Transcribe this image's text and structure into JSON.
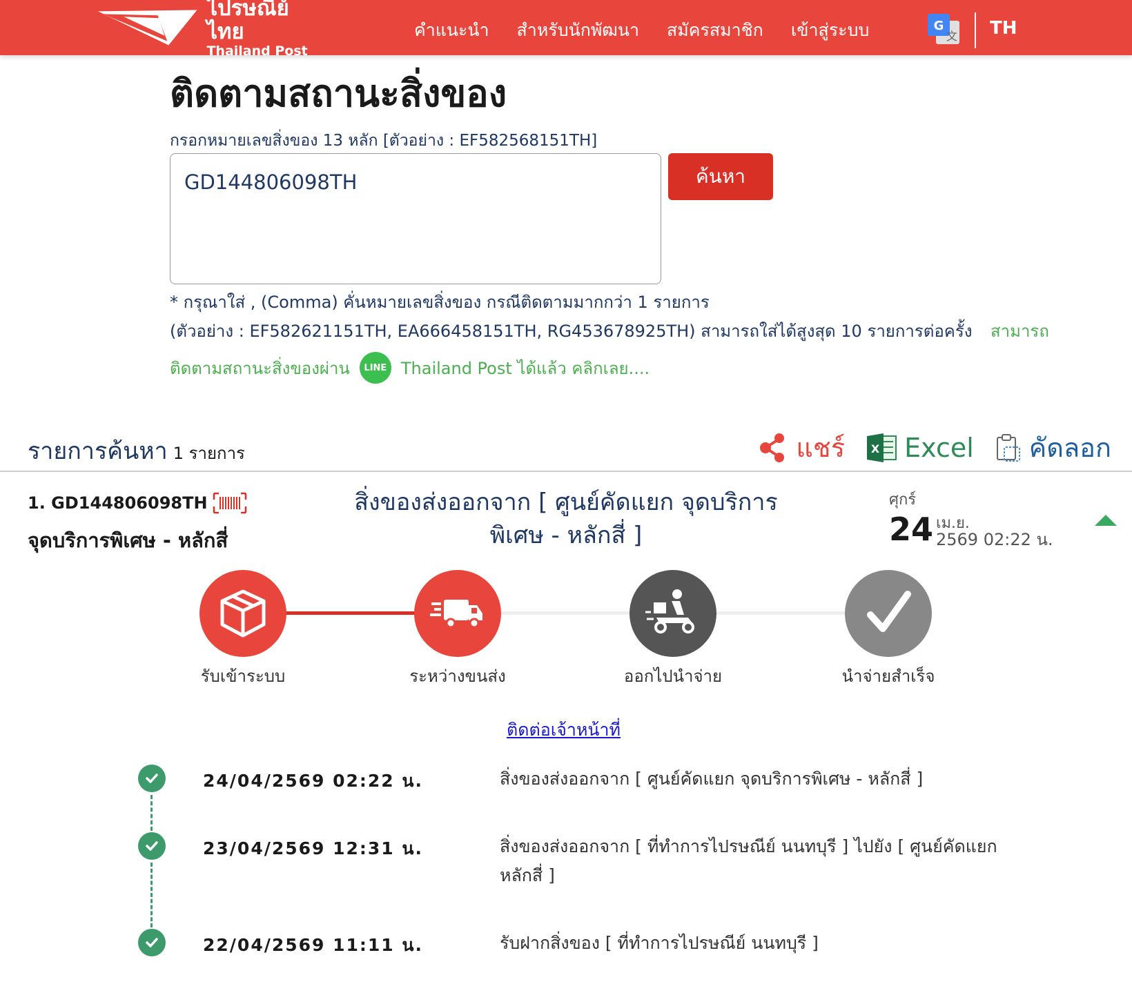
{
  "header": {
    "logo_th": "ไปรษณีย์ไทย",
    "logo_en": "Thailand Post",
    "nav": [
      "คำแนะนำ",
      "สำหรับนักพัฒนา",
      "สมัครสมาชิก",
      "เข้าสู่ระบบ"
    ],
    "lang": "TH",
    "brand_color": "#e8453c"
  },
  "search": {
    "title": "ติดตามสถานะสิ่งของ",
    "hint": "กรอกหมายเลขสิ่งของ 13 หลัก [ตัวอย่าง : EF582568151TH]",
    "value": "GD144806098TH",
    "button": "ค้นหา",
    "note1": "* กรุณาใส่ , (Comma) คั่นหมายเลขสิ่งของ กรณีติดตามมากกว่า 1 รายการ",
    "note2": "(ตัวอย่าง : EF582621151TH, EA666458151TH, RG453678925TH) สามารถใส่ได้สูงสุด 10 รายการต่อครั้ง",
    "note2_green": "สามารถ",
    "line_prefix": "ติดตามสถานะสิ่งของผ่าน",
    "line_badge": "LINE",
    "line_suffix": "Thailand Post ได้แล้ว คลิกเลย...."
  },
  "results": {
    "title": "รายการค้นหา",
    "count": "1 รายการ",
    "share": "แชร์",
    "excel": "Excel",
    "copy": "คัดลอก"
  },
  "item": {
    "id": "1. GD144806098TH",
    "location": "จุดบริการพิเศษ - หลักสี่",
    "status": "สิ่งของส่งออกจาก [ ศูนย์คัดแยก จุดบริการพิเศษ - หลักสี่ ]",
    "day_name": "ศุกร์",
    "day": "24",
    "month": "เม.ย.",
    "year_time": "2569 02:22 น."
  },
  "steps": [
    {
      "label": "รับเข้าระบบ",
      "icon": "box-icon",
      "state": "done"
    },
    {
      "label": "ระหว่างขนส่ง",
      "icon": "truck-icon",
      "state": "current"
    },
    {
      "label": "ออกไปนำจ่าย",
      "icon": "scooter-icon",
      "state": "pending"
    },
    {
      "label": "นำจ่ายสำเร็จ",
      "icon": "check-icon",
      "state": "pending"
    }
  ],
  "contact": "ติดต่อเจ้าหน้าที่",
  "timeline": [
    {
      "datetime": "24/04/2569 02:22 น.",
      "desc": "สิ่งของส่งออกจาก [ ศูนย์คัดแยก จุดบริการพิเศษ - หลักสี่ ]"
    },
    {
      "datetime": "23/04/2569 12:31 น.",
      "desc": "สิ่งของส่งออกจาก [ ที่ทำการไปรษณีย์ นนทบุรี ] ไปยัง [ ศูนย์คัดแยก หลักสี่ ]"
    },
    {
      "datetime": "22/04/2569 11:11 น.",
      "desc": "รับฝากสิ่งของ [ ที่ทำการไปรษณีย์ นนทบุรี ]"
    }
  ]
}
